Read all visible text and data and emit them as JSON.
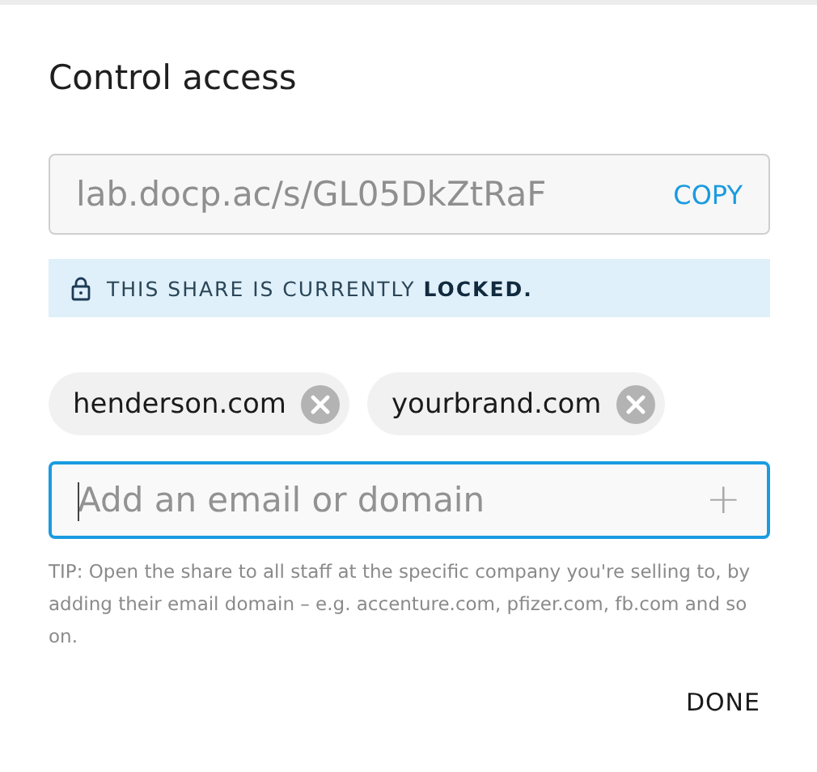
{
  "dialog": {
    "title": "Control access"
  },
  "share_link": {
    "value": "lab.docp.ac/s/GL05DkZtRaF",
    "copy_label": "COPY"
  },
  "status_banner": {
    "text": "THIS SHARE IS CURRENTLY **LOCKED.**"
  },
  "chips": [
    {
      "label": "henderson.com"
    },
    {
      "label": "yourbrand.com"
    }
  ],
  "add_field": {
    "placeholder": "Add an email or domain",
    "focused": true,
    "add_symbol": "+"
  },
  "tip": "TIP: Open the share to all staff at the specific company you're selling to, by adding their email domain – e.g. accenture.com, pfizer.com, fb.com and so on.",
  "buttons": [
    "DONE"
  ]
}
